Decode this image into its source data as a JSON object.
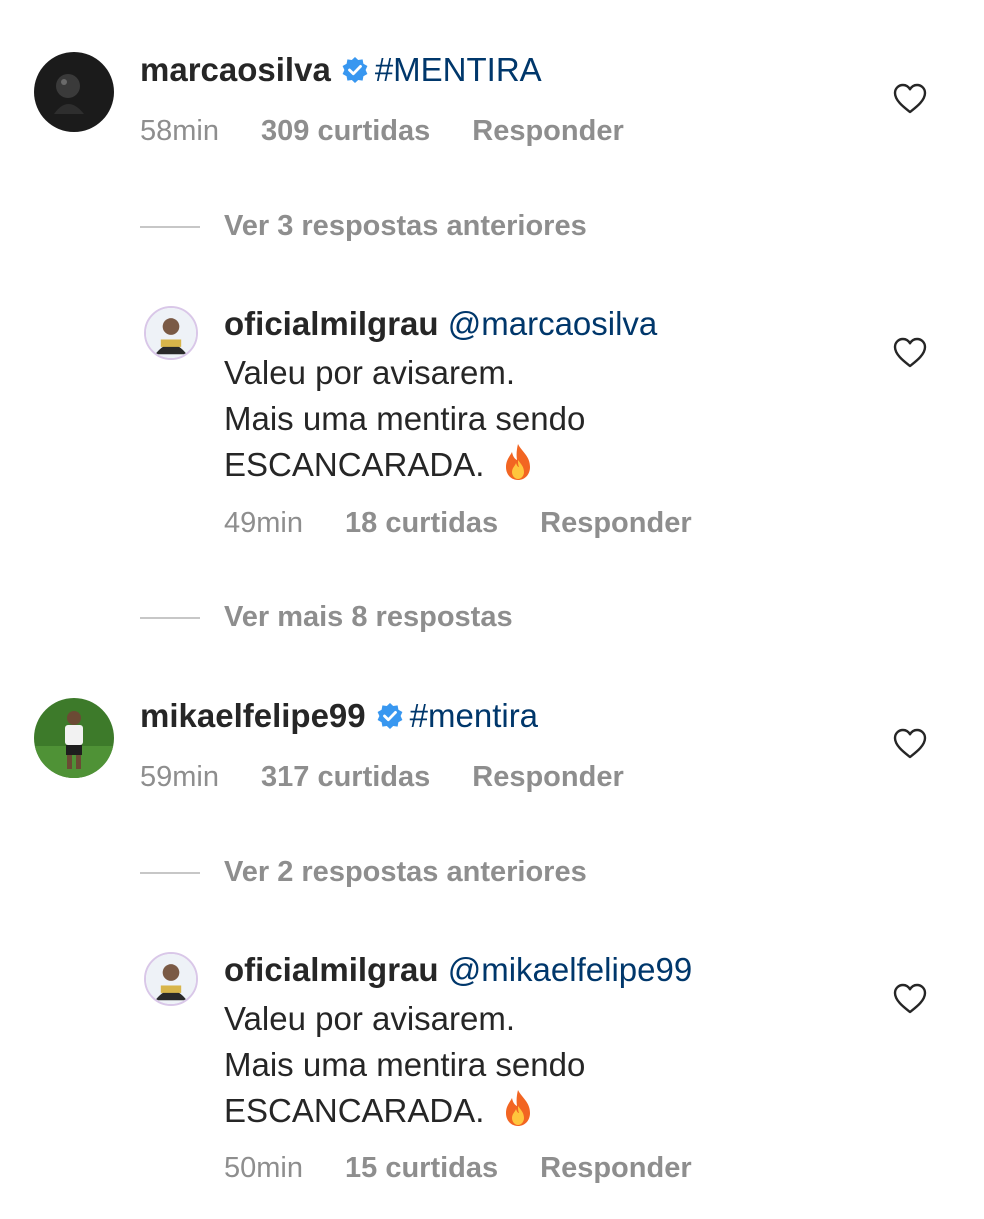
{
  "comments": [
    {
      "username": "marcaosilva",
      "verified": true,
      "text": "#MENTIRA",
      "time": "58min",
      "likes": "309 curtidas",
      "reply": "Responder",
      "view_replies": "Ver 3 respostas anteriores",
      "reply_item": {
        "username": "oficialmilgrau",
        "mention": "@marcaosilva",
        "lines": [
          "Valeu por avisarem.",
          "Mais uma mentira sendo",
          "ESCANCARADA."
        ],
        "time": "49min",
        "likes": "18 curtidas",
        "reply": "Responder"
      },
      "more_replies": "Ver mais 8 respostas"
    },
    {
      "username": "mikaelfelipe99",
      "verified": true,
      "text": "#mentira",
      "time": "59min",
      "likes": "317 curtidas",
      "reply": "Responder",
      "view_replies": "Ver 2 respostas anteriores",
      "reply_item": {
        "username": "oficialmilgrau",
        "mention": "@mikaelfelipe99",
        "lines": [
          "Valeu por avisarem.",
          "Mais uma mentira sendo",
          "ESCANCARADA."
        ],
        "time": "50min",
        "likes": "15 curtidas",
        "reply": "Responder"
      }
    }
  ],
  "icons": {
    "verified": "verified-badge-icon",
    "heart": "heart-outline-icon",
    "fire": "fire-emoji-icon"
  },
  "colors": {
    "verified_blue": "#3897f0",
    "link": "#00376b",
    "meta": "#8e8e8e"
  }
}
